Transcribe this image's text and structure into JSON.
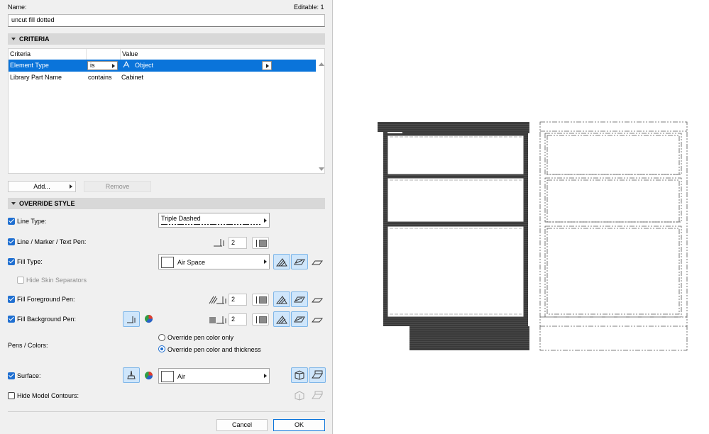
{
  "header": {
    "name_label": "Name:",
    "editable_label": "Editable: 1",
    "name_value": "uncut fill dotted"
  },
  "criteria": {
    "section_title": "CRITERIA",
    "columns": [
      "Criteria",
      "",
      "Value"
    ],
    "rows": [
      {
        "criteria": "Element Type",
        "op": "is",
        "value": "Object"
      },
      {
        "criteria": "Library Part Name",
        "op": "contains",
        "value": "Cabinet"
      }
    ],
    "add_label": "Add...",
    "remove_label": "Remove"
  },
  "override": {
    "section_title": "OVERRIDE STYLE",
    "line_type_label": "Line Type:",
    "line_type_value": "Triple Dashed",
    "line_pen_label": "Line / Marker / Text Pen:",
    "line_pen_value": "2",
    "fill_type_label": "Fill Type:",
    "fill_type_value": "Air Space",
    "hide_skin_label": "Hide Skin Separators",
    "fill_fg_label": "Fill Foreground Pen:",
    "fill_fg_value": "2",
    "fill_bg_label": "Fill Background Pen:",
    "fill_bg_value": "2",
    "pens_colors_label": "Pens / Colors:",
    "radio_color_only": "Override pen color only",
    "radio_color_thickness": "Override pen color and thickness",
    "surface_label": "Surface:",
    "surface_value": "Air",
    "hide_contours_label": "Hide Model Contours:"
  },
  "footer": {
    "cancel_label": "Cancel",
    "ok_label": "OK"
  },
  "colors": {
    "accent": "#0a74da",
    "selection": "#0a74da",
    "panel_bg": "#f0f0f0"
  }
}
